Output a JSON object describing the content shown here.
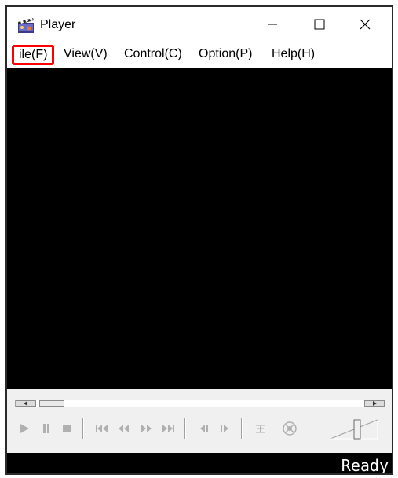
{
  "window": {
    "title": "Player",
    "controls": [
      "minimize",
      "maximize",
      "close"
    ]
  },
  "menu": {
    "file": "ile(F)",
    "view": "View(V)",
    "control": "Control(C)",
    "option": "Option(P)",
    "help": "Help(H)"
  },
  "seekbar": {
    "position": 0
  },
  "controls": {
    "icons": [
      "play-icon",
      "pause-icon",
      "stop-icon",
      "skip-back-icon",
      "rewind-icon",
      "fast-forward-icon",
      "skip-forward-icon",
      "step-back-icon",
      "step-forward-icon",
      "playlist-icon",
      "shuffle-icon",
      "volume-slider"
    ]
  },
  "status": {
    "text": "Ready"
  },
  "colors": {
    "highlight_box": "#ff0000",
    "video_bg": "#000000",
    "toolbar_bg": "#f0f0f0",
    "disabled_icon": "#b0b0b0"
  }
}
